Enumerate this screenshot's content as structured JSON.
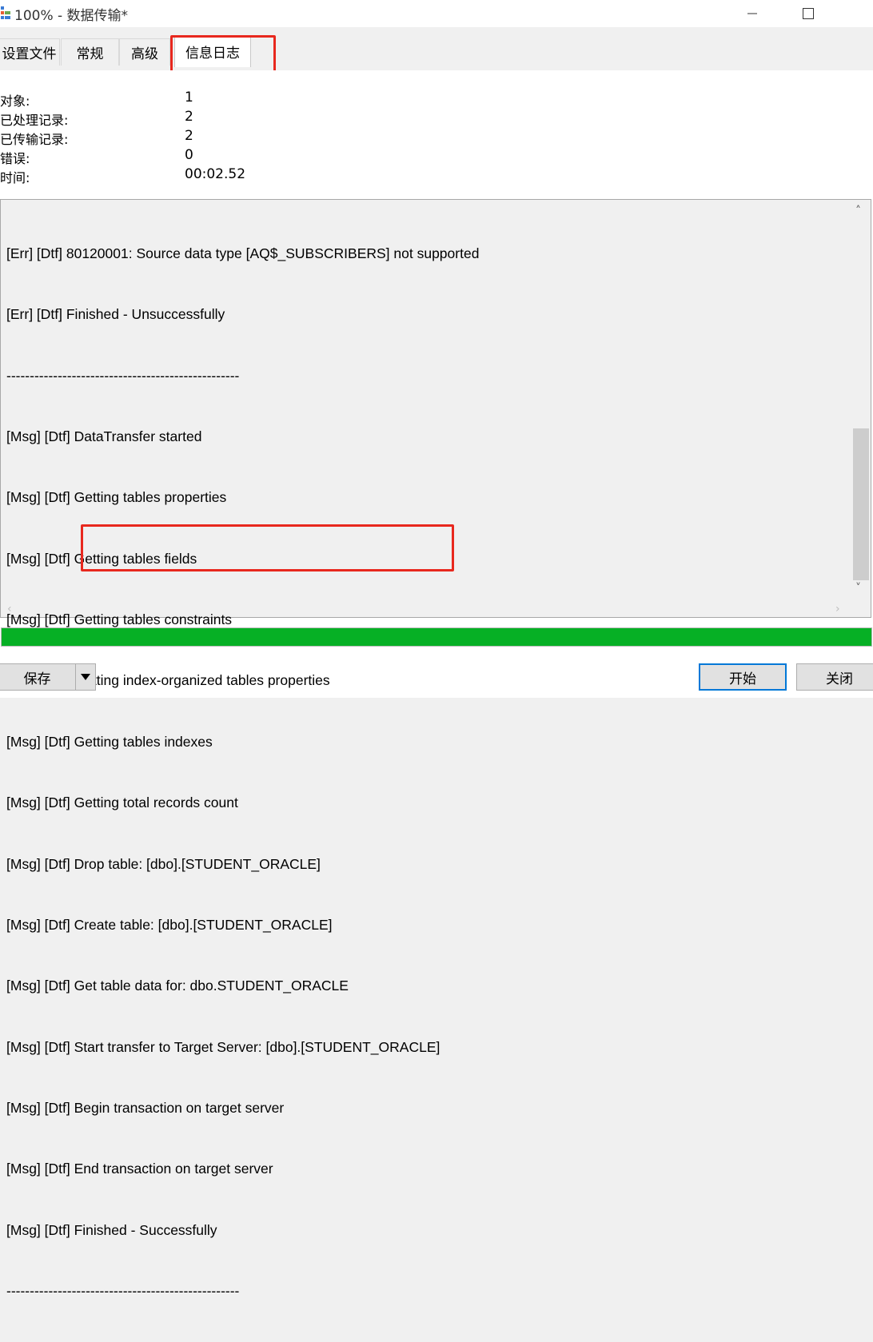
{
  "window": {
    "title": "100% - 数据传输*"
  },
  "tabs": [
    {
      "label": "设置文件"
    },
    {
      "label": "常规"
    },
    {
      "label": "高级"
    },
    {
      "label": "信息日志",
      "active": true
    }
  ],
  "stats": [
    {
      "label": "对象:",
      "value": "1"
    },
    {
      "label": "已处理记录:",
      "value": "2"
    },
    {
      "label": "已传输记录:",
      "value": "2"
    },
    {
      "label": "错误:",
      "value": "0"
    },
    {
      "label": "时间:",
      "value": "00:02.52"
    }
  ],
  "log": {
    "lines": [
      "[Err] [Dtf] 80120001: Source data type [AQ$_SUBSCRIBERS] not supported",
      "[Err] [Dtf] Finished - Unsuccessfully",
      "--------------------------------------------------",
      "[Msg] [Dtf] DataTransfer started",
      "[Msg] [Dtf] Getting tables properties",
      "[Msg] [Dtf] Getting tables fields",
      "[Msg] [Dtf] Getting tables constraints",
      "[Msg] [Dtf] Getting index-organized tables properties",
      "[Msg] [Dtf] Getting tables indexes",
      "[Msg] [Dtf] Getting total records count",
      "[Msg] [Dtf] Drop table: [dbo].[STUDENT_ORACLE]",
      "[Msg] [Dtf] Create table: [dbo].[STUDENT_ORACLE]",
      "[Msg] [Dtf] Get table data for: dbo.STUDENT_ORACLE",
      "[Msg] [Dtf] Start transfer to Target Server: [dbo].[STUDENT_ORACLE]",
      "[Msg] [Dtf] Begin transaction on target server",
      "[Msg] [Dtf] End transaction on target server",
      "[Msg] [Dtf] Finished - Successfully",
      "--------------------------------------------------"
    ]
  },
  "progress": {
    "percent": 100,
    "color": "#06b025"
  },
  "buttons": {
    "save": "保存",
    "start": "开始",
    "close": "关闭"
  },
  "colors": {
    "highlight": "#e8281e",
    "focus_border": "#0078d7"
  }
}
